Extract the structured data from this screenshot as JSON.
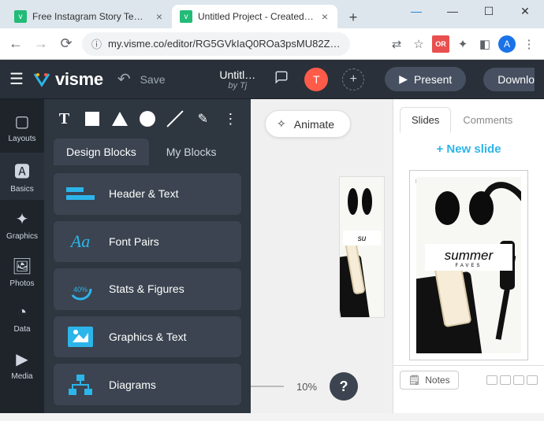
{
  "browser": {
    "tabs": [
      {
        "label": "Free Instagram Story Templa"
      },
      {
        "label": "Untitled Project - Created wi"
      }
    ],
    "url": "my.visme.co/editor/RG5GVkIaQ0ROa3psMU82ZGV…",
    "avatar_letter": "A",
    "ext_badge": "OR"
  },
  "header": {
    "brand": "visme",
    "save": "Save",
    "title": "Untitl…",
    "by": "by Tj",
    "user_letter": "T",
    "present": "Present",
    "download": "Downlo"
  },
  "rail": {
    "items": [
      "Layouts",
      "Basics",
      "Graphics",
      "Photos",
      "Data",
      "Media"
    ]
  },
  "panel": {
    "tabs": {
      "design": "Design Blocks",
      "my": "My Blocks"
    },
    "blocks": [
      "Header & Text",
      "Font Pairs",
      "Stats & Figures",
      "Graphics & Text",
      "Diagrams"
    ]
  },
  "canvas": {
    "animate": "Animate",
    "zoom": "10%",
    "thumb_label_main": "summer",
    "thumb_label_sub": "FAVES",
    "thumb_label_partial": "su"
  },
  "slides": {
    "tabs": {
      "slides": "Slides",
      "comments": "Comments"
    },
    "new_slide": "+ New slide",
    "notes": "Notes"
  }
}
